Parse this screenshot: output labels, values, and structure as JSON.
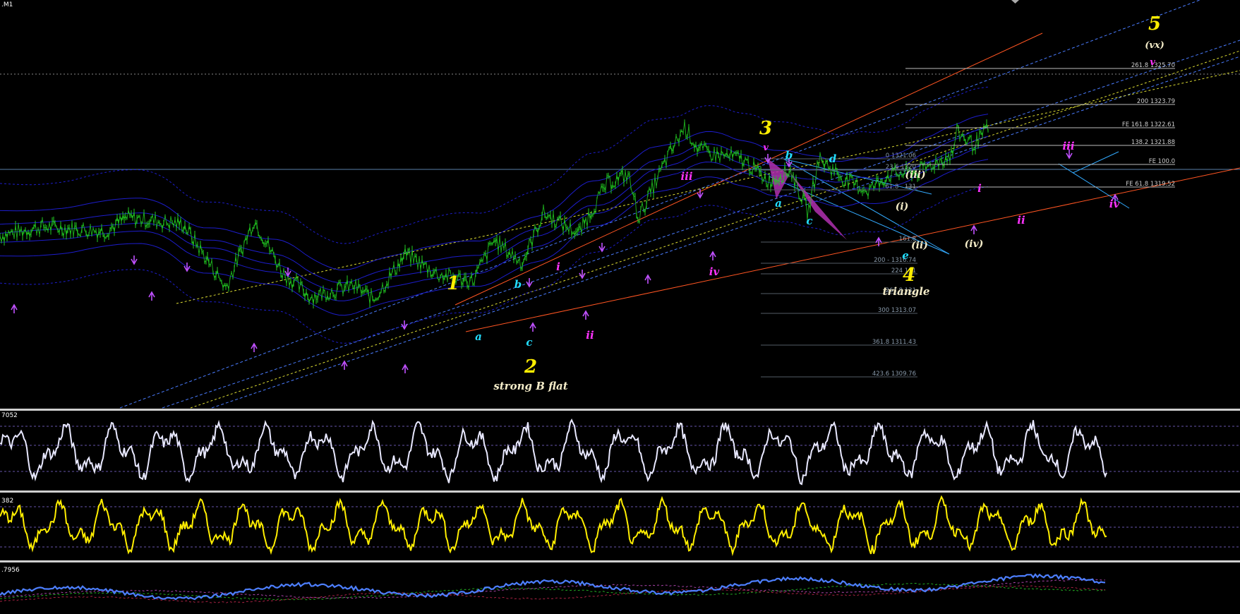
{
  "window": {
    "title": ".M1"
  },
  "colors": {
    "background": "#000000",
    "price": "#22cc22",
    "channel": "#ff5522",
    "bands": "#1d1dcc",
    "fib": "#99aabb",
    "wave_primary": "#ffee00",
    "wave_minor": "#ff33ff",
    "wave_sub": "#22ddff",
    "wave_paren": "#f4ecc8",
    "osc1": "#e8e8ff",
    "osc2": "#ffee00",
    "osc3": "#4d7fff",
    "pattern": "#b030b0"
  },
  "main_pane": {
    "fib_levels": [
      {
        "label": "261.8 1325.70",
        "line_from": 1145
      },
      {
        "label": "200 1323.79",
        "line_from": 1145
      },
      {
        "label": "FE 161.8 1322.61",
        "line_from": 1145
      },
      {
        "label": "138.2 1321.88",
        "line_from": 1145
      },
      {
        "label": "FE 100.0",
        "line_from": 1145
      },
      {
        "label": "FE 61.8 1319.52",
        "line_from": 1145
      }
    ],
    "retrace_levels": [
      {
        "label": "0 1321.06"
      },
      {
        "label": "23.6 1320"
      },
      {
        "label": "61.8 - 131"
      },
      {
        "label": "161.8"
      },
      {
        "label": "200 - 1316.74"
      },
      {
        "label": "224 131"
      },
      {
        "label": "261.8 131"
      },
      {
        "label": "300 1313.07"
      },
      {
        "label": "361.8 1311.43"
      },
      {
        "label": "423.6 1309.76"
      }
    ],
    "wave_labels": [
      {
        "text": "1",
        "kind": "primary"
      },
      {
        "text": "2",
        "kind": "primary"
      },
      {
        "text": "3",
        "kind": "primary"
      },
      {
        "text": "4",
        "kind": "primary"
      },
      {
        "text": "5",
        "kind": "primary"
      },
      {
        "text": "strong B flat",
        "kind": "paren"
      },
      {
        "text": "triangle",
        "kind": "paren"
      },
      {
        "text": "(vx)",
        "kind": "paren"
      },
      {
        "text": "(i)",
        "kind": "paren"
      },
      {
        "text": "(ii)",
        "kind": "paren"
      },
      {
        "text": "(iii)",
        "kind": "paren"
      },
      {
        "text": "(iv)",
        "kind": "paren"
      },
      {
        "text": "a",
        "kind": "sub"
      },
      {
        "text": "b",
        "kind": "sub"
      },
      {
        "text": "c",
        "kind": "sub"
      },
      {
        "text": "a",
        "kind": "sub"
      },
      {
        "text": "b",
        "kind": "sub"
      },
      {
        "text": "c",
        "kind": "sub"
      },
      {
        "text": "d",
        "kind": "sub"
      },
      {
        "text": "e",
        "kind": "sub"
      },
      {
        "text": "i",
        "kind": "minor"
      },
      {
        "text": "ii",
        "kind": "minor"
      },
      {
        "text": "iii",
        "kind": "minor"
      },
      {
        "text": "iv",
        "kind": "minor"
      },
      {
        "text": "v",
        "kind": "minor"
      },
      {
        "text": "i",
        "kind": "minor"
      },
      {
        "text": "ii",
        "kind": "minor"
      },
      {
        "text": "iii",
        "kind": "minor"
      },
      {
        "text": "iv",
        "kind": "minor"
      },
      {
        "text": "v",
        "kind": "minor"
      }
    ]
  },
  "indicator_panes": [
    {
      "name": "osc1",
      "label": "7052"
    },
    {
      "name": "osc2",
      "label": "382"
    },
    {
      "name": "osc3",
      "label": ".7956"
    }
  ],
  "chart_data": {
    "type": "line",
    "title": "",
    "xlabel": "",
    "ylabel": "",
    "series": [
      {
        "name": "",
        "note_points": [
          [
            0,
            1316.2
          ],
          [
            60,
            1316.6
          ],
          [
            150,
            1316.4
          ],
          [
            180,
            1317.0
          ],
          [
            260,
            1316.7
          ],
          [
            320,
            1313.9
          ],
          [
            360,
            1316.9
          ],
          [
            400,
            1314.6
          ],
          [
            440,
            1313.5
          ],
          [
            500,
            1314.0
          ],
          [
            530,
            1313.4
          ],
          [
            575,
            1315.4
          ],
          [
            620,
            1314.5
          ],
          [
            670,
            1314.2
          ],
          [
            700,
            1316.0
          ],
          [
            740,
            1315.0
          ],
          [
            770,
            1317.2
          ],
          [
            820,
            1316.3
          ],
          [
            860,
            1318.5
          ],
          [
            890,
            1318.9
          ],
          [
            905,
            1317.0
          ],
          [
            945,
            1319.6
          ],
          [
            970,
            1321.0
          ],
          [
            990,
            1320.0
          ],
          [
            1010,
            1319.8
          ],
          [
            1050,
            1319.6
          ],
          [
            1090,
            1318.6
          ],
          [
            1120,
            1319.1
          ],
          [
            1145,
            1317.2
          ],
          [
            1160,
            1319.6
          ],
          [
            1200,
            1318.6
          ],
          [
            1230,
            1318.2
          ],
          [
            1260,
            1318.9
          ],
          [
            1300,
            1319.0
          ],
          [
            1350,
            1319.8
          ],
          [
            1355,
            1320.8
          ],
          [
            1380,
            1320.2
          ],
          [
            1400,
            1320.9
          ]
        ]
      }
    ],
    "ylim": [
      1308.6,
      1326.6
    ],
    "xlim": [
      0,
      1757
    ]
  }
}
